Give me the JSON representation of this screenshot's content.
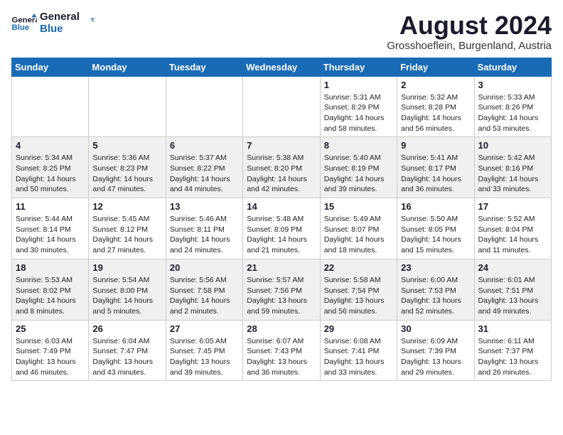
{
  "logo": {
    "text_general": "General",
    "text_blue": "Blue"
  },
  "title": {
    "month_year": "August 2024",
    "location": "Grosshoeflein, Burgenland, Austria"
  },
  "headers": [
    "Sunday",
    "Monday",
    "Tuesday",
    "Wednesday",
    "Thursday",
    "Friday",
    "Saturday"
  ],
  "weeks": [
    [
      {
        "day": "",
        "info": ""
      },
      {
        "day": "",
        "info": ""
      },
      {
        "day": "",
        "info": ""
      },
      {
        "day": "",
        "info": ""
      },
      {
        "day": "1",
        "info": "Sunrise: 5:31 AM\nSunset: 8:29 PM\nDaylight: 14 hours\nand 58 minutes."
      },
      {
        "day": "2",
        "info": "Sunrise: 5:32 AM\nSunset: 8:28 PM\nDaylight: 14 hours\nand 56 minutes."
      },
      {
        "day": "3",
        "info": "Sunrise: 5:33 AM\nSunset: 8:26 PM\nDaylight: 14 hours\nand 53 minutes."
      }
    ],
    [
      {
        "day": "4",
        "info": "Sunrise: 5:34 AM\nSunset: 8:25 PM\nDaylight: 14 hours\nand 50 minutes."
      },
      {
        "day": "5",
        "info": "Sunrise: 5:36 AM\nSunset: 8:23 PM\nDaylight: 14 hours\nand 47 minutes."
      },
      {
        "day": "6",
        "info": "Sunrise: 5:37 AM\nSunset: 8:22 PM\nDaylight: 14 hours\nand 44 minutes."
      },
      {
        "day": "7",
        "info": "Sunrise: 5:38 AM\nSunset: 8:20 PM\nDaylight: 14 hours\nand 42 minutes."
      },
      {
        "day": "8",
        "info": "Sunrise: 5:40 AM\nSunset: 8:19 PM\nDaylight: 14 hours\nand 39 minutes."
      },
      {
        "day": "9",
        "info": "Sunrise: 5:41 AM\nSunset: 8:17 PM\nDaylight: 14 hours\nand 36 minutes."
      },
      {
        "day": "10",
        "info": "Sunrise: 5:42 AM\nSunset: 8:16 PM\nDaylight: 14 hours\nand 33 minutes."
      }
    ],
    [
      {
        "day": "11",
        "info": "Sunrise: 5:44 AM\nSunset: 8:14 PM\nDaylight: 14 hours\nand 30 minutes."
      },
      {
        "day": "12",
        "info": "Sunrise: 5:45 AM\nSunset: 8:12 PM\nDaylight: 14 hours\nand 27 minutes."
      },
      {
        "day": "13",
        "info": "Sunrise: 5:46 AM\nSunset: 8:11 PM\nDaylight: 14 hours\nand 24 minutes."
      },
      {
        "day": "14",
        "info": "Sunrise: 5:48 AM\nSunset: 8:09 PM\nDaylight: 14 hours\nand 21 minutes."
      },
      {
        "day": "15",
        "info": "Sunrise: 5:49 AM\nSunset: 8:07 PM\nDaylight: 14 hours\nand 18 minutes."
      },
      {
        "day": "16",
        "info": "Sunrise: 5:50 AM\nSunset: 8:05 PM\nDaylight: 14 hours\nand 15 minutes."
      },
      {
        "day": "17",
        "info": "Sunrise: 5:52 AM\nSunset: 8:04 PM\nDaylight: 14 hours\nand 11 minutes."
      }
    ],
    [
      {
        "day": "18",
        "info": "Sunrise: 5:53 AM\nSunset: 8:02 PM\nDaylight: 14 hours\nand 8 minutes."
      },
      {
        "day": "19",
        "info": "Sunrise: 5:54 AM\nSunset: 8:00 PM\nDaylight: 14 hours\nand 5 minutes."
      },
      {
        "day": "20",
        "info": "Sunrise: 5:56 AM\nSunset: 7:58 PM\nDaylight: 14 hours\nand 2 minutes."
      },
      {
        "day": "21",
        "info": "Sunrise: 5:57 AM\nSunset: 7:56 PM\nDaylight: 13 hours\nand 59 minutes."
      },
      {
        "day": "22",
        "info": "Sunrise: 5:58 AM\nSunset: 7:54 PM\nDaylight: 13 hours\nand 56 minutes."
      },
      {
        "day": "23",
        "info": "Sunrise: 6:00 AM\nSunset: 7:53 PM\nDaylight: 13 hours\nand 52 minutes."
      },
      {
        "day": "24",
        "info": "Sunrise: 6:01 AM\nSunset: 7:51 PM\nDaylight: 13 hours\nand 49 minutes."
      }
    ],
    [
      {
        "day": "25",
        "info": "Sunrise: 6:03 AM\nSunset: 7:49 PM\nDaylight: 13 hours\nand 46 minutes."
      },
      {
        "day": "26",
        "info": "Sunrise: 6:04 AM\nSunset: 7:47 PM\nDaylight: 13 hours\nand 43 minutes."
      },
      {
        "day": "27",
        "info": "Sunrise: 6:05 AM\nSunset: 7:45 PM\nDaylight: 13 hours\nand 39 minutes."
      },
      {
        "day": "28",
        "info": "Sunrise: 6:07 AM\nSunset: 7:43 PM\nDaylight: 13 hours\nand 36 minutes."
      },
      {
        "day": "29",
        "info": "Sunrise: 6:08 AM\nSunset: 7:41 PM\nDaylight: 13 hours\nand 33 minutes."
      },
      {
        "day": "30",
        "info": "Sunrise: 6:09 AM\nSunset: 7:39 PM\nDaylight: 13 hours\nand 29 minutes."
      },
      {
        "day": "31",
        "info": "Sunrise: 6:11 AM\nSunset: 7:37 PM\nDaylight: 13 hours\nand 26 minutes."
      }
    ]
  ]
}
